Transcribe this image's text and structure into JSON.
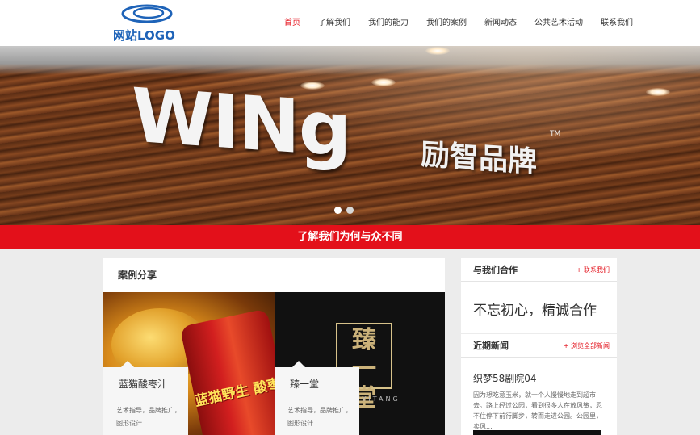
{
  "logo": {
    "text": "网站LOGO"
  },
  "nav": {
    "items": [
      "首页",
      "了解我们",
      "我们的能力",
      "我们的案例",
      "新闻动态",
      "公共艺术活动",
      "联系我们"
    ],
    "active_index": 0
  },
  "banner": {
    "brand_en": "WINg",
    "brand_cn": "励智品牌",
    "tm": "TM",
    "slide_count": 2,
    "active_slide": 0
  },
  "tagline": "了解我们为何与众不同",
  "cases": {
    "title": "案例分享",
    "items": [
      {
        "name": "蓝猫酸枣汁",
        "desc": "艺术指导，品牌推广，图形设计",
        "image_text": "蓝猫野生 酸枣汁"
      },
      {
        "name": "臻一堂",
        "desc": "艺术指导，品牌推广，图形设计",
        "image_text": "臻 一 堂",
        "image_pinyin": "ZHENYITANG"
      }
    ]
  },
  "cooperate": {
    "title": "与我们合作",
    "link": "+ 联系我们",
    "slogan": "不忘初心，精诚合作"
  },
  "news": {
    "title": "近期新闻",
    "link": "+ 浏览全部新闻",
    "item_title": "织梦58剧院04",
    "item_text": "因为想吃意玉米，就一个人慢慢地走到超市去。路上经过公园，看到很多人在放风筝，忍不住停下前行脚步，转而走进公园。公园里，卖风..."
  },
  "colors": {
    "accent": "#e3101a",
    "logo_blue": "#1e63b8"
  }
}
